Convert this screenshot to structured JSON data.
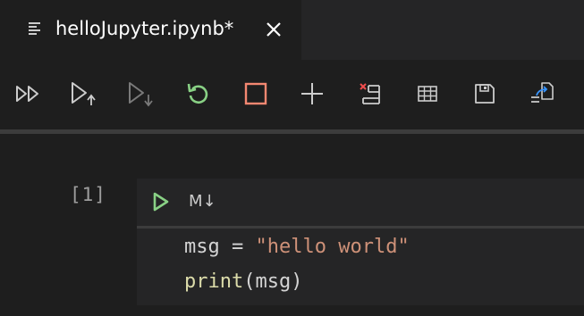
{
  "tab": {
    "title": "helloJupyter.ipynb*",
    "file_icon": "lines-icon",
    "close_icon": "close-icon"
  },
  "toolbar": {
    "items": [
      {
        "name": "run-all",
        "icon": "double-play-icon"
      },
      {
        "name": "run-above",
        "icon": "play-up-arrow-icon"
      },
      {
        "name": "run-below",
        "icon": "play-down-arrow-icon"
      },
      {
        "name": "restart-kernel",
        "icon": "restart-icon"
      },
      {
        "name": "interrupt-kernel",
        "icon": "stop-square-icon"
      },
      {
        "name": "insert-cell",
        "icon": "plus-icon"
      },
      {
        "name": "clear-outputs",
        "icon": "clear-outputs-icon"
      },
      {
        "name": "variable-explorer",
        "icon": "table-icon"
      },
      {
        "name": "save",
        "icon": "save-icon"
      },
      {
        "name": "export",
        "icon": "export-icon"
      }
    ]
  },
  "cell": {
    "execution_count": "[1]",
    "type_toggle": "M↓",
    "code": {
      "line1_var": "msg",
      "line1_op": " = ",
      "line1_str": "\"hello world\"",
      "line2_fn": "print",
      "line2_args": "(msg)"
    }
  },
  "colors": {
    "background": "#1e1e1e",
    "tabbar": "#252526",
    "run_green": "#89d185",
    "stop_orange": "#f48771",
    "string": "#ce9178",
    "function": "#dcdcaa"
  }
}
